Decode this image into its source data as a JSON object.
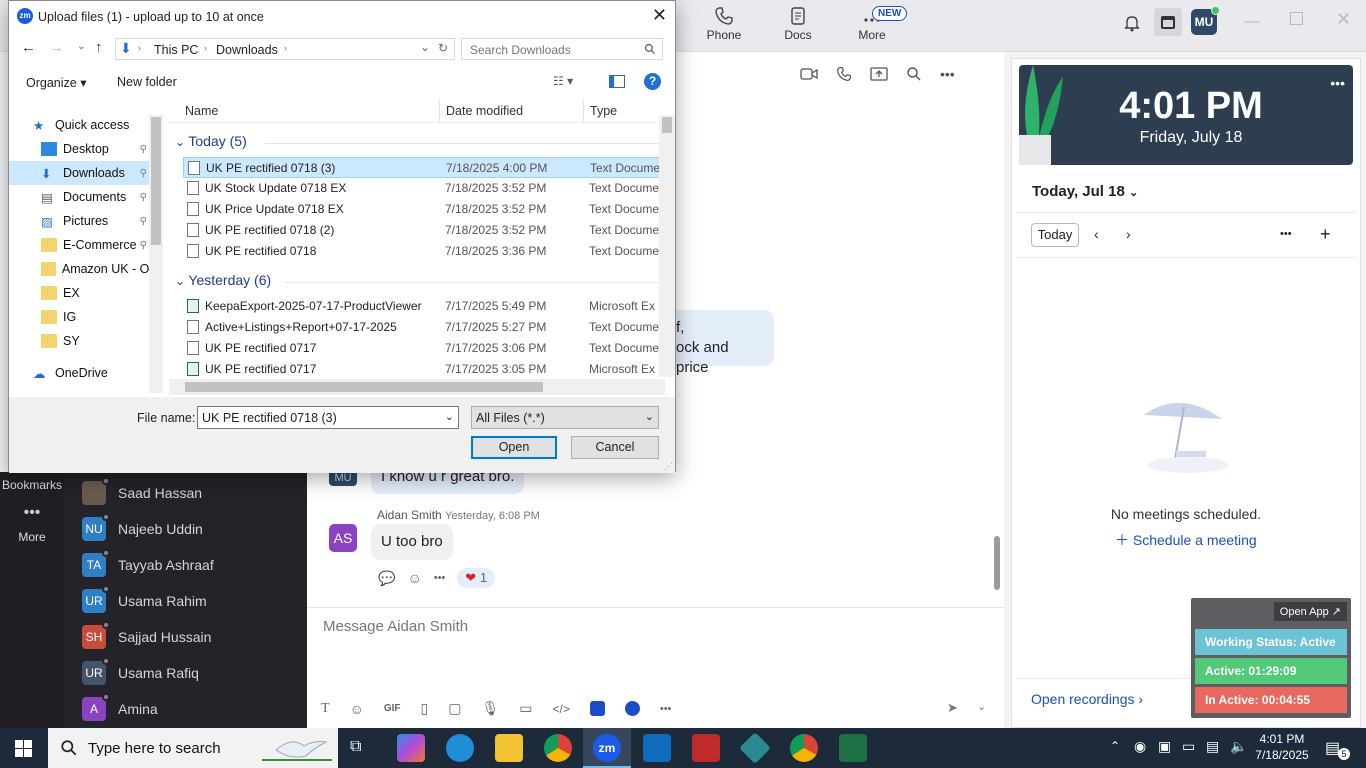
{
  "dialog": {
    "title": "Upload files (1) - upload up to 10 at once",
    "breadcrumb": [
      "This PC",
      "Downloads"
    ],
    "search_placeholder": "Search Downloads",
    "organize": "Organize",
    "new_folder": "New folder",
    "columns": {
      "name": "Name",
      "date": "Date modified",
      "type": "Type"
    },
    "nav": [
      "Quick access",
      "Desktop",
      "Downloads",
      "Documents",
      "Pictures",
      "E-Commerce",
      "Amazon UK - Oc",
      "EX",
      "IG",
      "SY",
      "OneDrive"
    ],
    "groups": [
      {
        "label": "Today (5)",
        "files": [
          {
            "name": "UK PE rectified 0718 (3)",
            "date": "7/18/2025 4:00 PM",
            "type": "Text Docume",
            "kind": "text",
            "selected": true
          },
          {
            "name": "UK Stock Update 0718 EX",
            "date": "7/18/2025 3:52 PM",
            "type": "Text Docume",
            "kind": "text"
          },
          {
            "name": "UK Price Update 0718 EX",
            "date": "7/18/2025 3:52 PM",
            "type": "Text Docume",
            "kind": "text"
          },
          {
            "name": "UK PE rectified 0718 (2)",
            "date": "7/18/2025 3:52 PM",
            "type": "Text Docume",
            "kind": "text"
          },
          {
            "name": "UK PE rectified 0718",
            "date": "7/18/2025 3:36 PM",
            "type": "Text Docume",
            "kind": "text"
          }
        ]
      },
      {
        "label": "Yesterday (6)",
        "files": [
          {
            "name": "KeepaExport-2025-07-17-ProductViewer",
            "date": "7/17/2025 5:49 PM",
            "type": "Microsoft Ex",
            "kind": "excel"
          },
          {
            "name": "Active+Listings+Report+07-17-2025",
            "date": "7/17/2025 5:27 PM",
            "type": "Text Docume",
            "kind": "text"
          },
          {
            "name": "UK PE rectified 0717",
            "date": "7/17/2025 3:06 PM",
            "type": "Text Docume",
            "kind": "text"
          },
          {
            "name": "UK PE rectified 0717",
            "date": "7/17/2025 3:05 PM",
            "type": "Microsoft Ex",
            "kind": "excel"
          }
        ]
      }
    ],
    "file_name_label": "File name:",
    "file_name_value": "UK PE rectified 0718 (3)",
    "file_type": "All Files (*.*)",
    "open": "Open",
    "cancel": "Cancel"
  },
  "topbar": {
    "phone": "Phone",
    "docs": "Docs",
    "more": "More",
    "new_badge": "NEW",
    "avatar": "MU"
  },
  "rail": {
    "bookmarks": "Bookmarks",
    "more": "More"
  },
  "contacts": [
    {
      "initials": "",
      "name": "Saad Hassan",
      "color": "#6b5b4f"
    },
    {
      "initials": "NU",
      "name": "Najeeb Uddin",
      "color": "#2e7fc4"
    },
    {
      "initials": "TA",
      "name": "Tayyab Ashraaf",
      "color": "#2e7fc4"
    },
    {
      "initials": "UR",
      "name": "Usama Rahim",
      "color": "#2e7fc4"
    },
    {
      "initials": "SH",
      "name": "Sajjad Hussain",
      "color": "#c94b3a"
    },
    {
      "initials": "UR",
      "name": "Usama Rafiq",
      "color": "#44546a"
    },
    {
      "initials": "A",
      "name": "Amina",
      "color": "#8a44c2"
    }
  ],
  "chat": {
    "partial1": "f,",
    "partial2": "ock and price",
    "mu_avatar": "MU",
    "my_msg": "I know u r great bro.",
    "sender": "Aidan Smith",
    "sender_time": "Yesterday, 6:08 PM",
    "sender_initials": "AS",
    "reply": "U too bro",
    "reaction_count": "1",
    "composer_placeholder": "Message Aidan Smith",
    "gif": "GIF"
  },
  "calendar": {
    "time": "4:01 PM",
    "date": "Friday, July 18",
    "heading": "Today, Jul 18",
    "today_btn": "Today",
    "empty": "No meetings scheduled.",
    "schedule": "Schedule a meeting",
    "recordings": "Open recordings"
  },
  "status": {
    "open_app": "Open App ↗",
    "working": "Working Status: Active",
    "active": "Active: 01:29:09",
    "inactive": "In Active: 00:04:55",
    "colors": {
      "working": "#6cc3d4",
      "active": "#55c97a",
      "inactive": "#e8675f"
    }
  },
  "taskbar": {
    "search": "Type here to search",
    "time": "4:01 PM",
    "date": "7/18/2025",
    "notif": "5"
  }
}
